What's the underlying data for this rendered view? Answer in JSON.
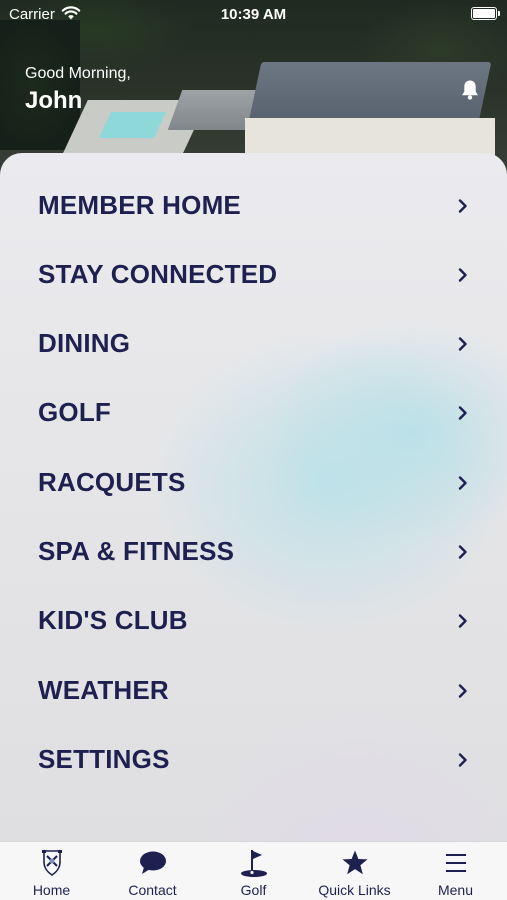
{
  "status_bar": {
    "carrier": "Carrier",
    "time": "10:39 AM",
    "wifi_icon": "wifi-icon",
    "battery_icon": "battery-icon",
    "battery_level": 1.0
  },
  "header": {
    "greeting": "Good Morning,",
    "user_name": "John",
    "notification_icon": "bell-icon"
  },
  "menu": {
    "items": [
      {
        "label": "MEMBER HOME"
      },
      {
        "label": "STAY CONNECTED"
      },
      {
        "label": "DINING"
      },
      {
        "label": "GOLF"
      },
      {
        "label": "RACQUETS"
      },
      {
        "label": "SPA & FITNESS"
      },
      {
        "label": "KID'S CLUB"
      },
      {
        "label": "WEATHER"
      },
      {
        "label": "SETTINGS"
      }
    ],
    "chevron_icon": "chevron-right-icon"
  },
  "tab_bar": {
    "tabs": [
      {
        "label": "Home",
        "icon": "crest-icon"
      },
      {
        "label": "Contact",
        "icon": "chat-bubble-icon"
      },
      {
        "label": "Golf",
        "icon": "golf-flag-icon"
      },
      {
        "label": "Quick Links",
        "icon": "star-icon"
      },
      {
        "label": "Menu",
        "icon": "hamburger-menu-icon"
      }
    ]
  },
  "colors": {
    "menu_text": "#1e2150",
    "tab_icon": "#1e2150",
    "tab_bar_bg": "#f7f7f8"
  }
}
